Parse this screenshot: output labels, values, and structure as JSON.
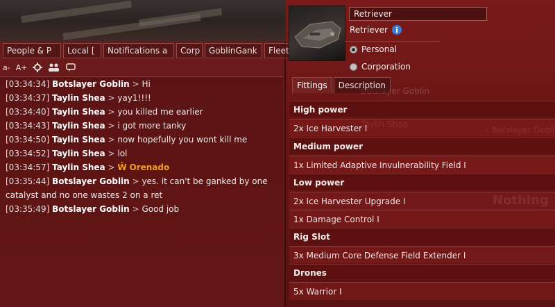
{
  "chat": {
    "tabs": [
      "People & P",
      "Local [",
      "Notifications a",
      "Corp",
      "GoblinGank",
      "Fleet"
    ],
    "font_decrease": "a-",
    "font_increase": "A+",
    "messages": [
      {
        "time": "[03:34:34]",
        "speaker": "Botslayer Goblin",
        "sep": ">",
        "text": "Hi"
      },
      {
        "time": "[03:34:37]",
        "speaker": "Taylin Shea",
        "sep": ">",
        "text": "yay1!!!!"
      },
      {
        "time": "[03:34:40]",
        "speaker": "Taylin Shea",
        "sep": ">",
        "text": "you killed me earlier"
      },
      {
        "time": "[03:34:43]",
        "speaker": "Taylin Shea",
        "sep": ">",
        "text": "i got more tanky"
      },
      {
        "time": "[03:34:50]",
        "speaker": "Taylin Shea",
        "sep": ">",
        "text": "now hopefully you wont kill me"
      },
      {
        "time": "[03:34:52]",
        "speaker": "Taylin Shea",
        "sep": ">",
        "text": "lol"
      },
      {
        "time": "[03:34:57]",
        "speaker": "Taylin Shea",
        "sep": ">",
        "link_icon": "Ŵ",
        "link_text": "Orenado"
      },
      {
        "time": "[03:35:44]",
        "speaker": "Botslayer Goblin",
        "sep": ">",
        "text": "yes. it can't be ganked by one",
        "text2": "catalyst and no one wastes 2 on a ret"
      },
      {
        "time": "[03:35:49]",
        "speaker": "Botslayer Goblin",
        "sep": ">",
        "text": "Good job"
      }
    ]
  },
  "fitting": {
    "name_value": "Retriever",
    "ship_type": "Retriever",
    "ownership": [
      {
        "label": "Personal",
        "selected": true
      },
      {
        "label": "Corporation",
        "selected": false
      }
    ],
    "tabs": [
      {
        "label": "Fittings",
        "active": true
      },
      {
        "label": "Description",
        "active": false
      }
    ],
    "sections": [
      {
        "title": "High power",
        "items": [
          "2x Ice Harvester I"
        ]
      },
      {
        "title": "Medium power",
        "items": [
          "1x Limited Adaptive Invulnerability Field I"
        ]
      },
      {
        "title": "Low power",
        "items": [
          "2x Ice Harvester Upgrade I",
          "1x Damage Control I"
        ]
      },
      {
        "title": "Rig Slot",
        "items": [
          "3x Medium Core Defense Field Extender I"
        ]
      },
      {
        "title": "Drones",
        "items": [
          "5x Warrior I"
        ]
      }
    ]
  },
  "colors": {
    "accent_link": "#f0a020",
    "panel_red": "#6b1a1a",
    "info_blue": "#3a7ad8"
  }
}
